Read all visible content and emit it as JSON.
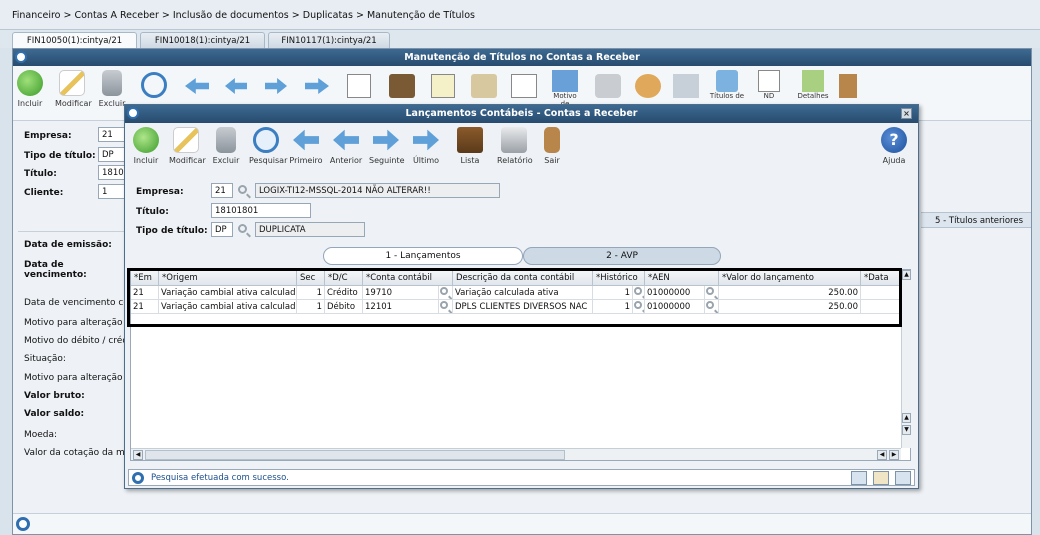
{
  "breadcrumb": "Financeiro > Contas A Receber > Inclusão de documentos > Duplicatas > Manutenção de Títulos",
  "tabs": [
    {
      "label": "FIN10050(1):cintya/21"
    },
    {
      "label": "FIN10018(1):cintya/21"
    },
    {
      "label": "FIN10117(1):cintya/21"
    }
  ],
  "main": {
    "title": "Manutenção de Títulos no Contas a Receber",
    "toolbar": {
      "incluir": "Incluir",
      "modificar": "Modificar",
      "excluir": "Excluir"
    },
    "top_partial_labels": {
      "motivo": "Motivo de",
      "titulos": "Títulos de",
      "nd": "ND",
      "detalhes": "Detalhes"
    },
    "fields": {
      "empresa_label": "Empresa:",
      "empresa": "21",
      "tipo_label": "Tipo de título:",
      "tipo": "DP",
      "titulo_label": "Título:",
      "titulo": "18101",
      "cliente_label": "Cliente:",
      "cliente": "1"
    },
    "titulos_anteriores": "5 - Títulos anteriores",
    "left_labels": {
      "data_emissao": "Data de emissão:",
      "data_vencimento": "Data de vencimento:",
      "data_venc_com": "Data de vencimento com",
      "motivo_alteracao": "Motivo para alteração de",
      "motivo_debito": "Motivo do débito / crédito:",
      "situacao": "Situação:",
      "motivo_alteracao_da": "Motivo para alteração da",
      "valor_bruto": "Valor bruto:",
      "valor_saldo": "Valor saldo:",
      "moeda": "Moeda:",
      "valor_cotacao": "Valor da cotação da moe"
    }
  },
  "modal": {
    "title": "Lançamentos Contábeis - Contas a Receber",
    "toolbar": {
      "incluir": "Incluir",
      "modificar": "Modificar",
      "excluir": "Excluir",
      "pesquisar": "Pesquisar",
      "primeiro": "Primeiro",
      "anterior": "Anterior",
      "seguinte": "Seguinte",
      "ultimo": "Último",
      "lista": "Lista",
      "relatorio": "Relatório",
      "sair": "Sair",
      "ajuda": "Ajuda"
    },
    "form": {
      "empresa_label": "Empresa:",
      "empresa": "21",
      "empresa_desc": "LOGIX-TI12-MSSQL-2014 NÃO ALTERAR!!",
      "titulo_label": "Título:",
      "titulo": "18101801",
      "tipo_label": "Tipo de título:",
      "tipo": "DP",
      "tipo_desc": "DUPLICATA"
    },
    "subtabs": [
      {
        "label": "1 - Lançamentos"
      },
      {
        "label": "2 - AVP"
      }
    ],
    "grid": {
      "headers": [
        "*Em",
        "*Origem",
        "Sec",
        "*D/C",
        "*Conta contábil",
        "Descrição da conta contábil",
        "*Histórico",
        "*AEN",
        "*Valor do lançamento",
        "*Data"
      ],
      "rows": [
        [
          "21",
          "Variação cambial ativa calculada",
          "1",
          "Crédito",
          "19710",
          "Variação calculada ativa",
          "1",
          "01000000",
          "250.00",
          ""
        ],
        [
          "21",
          "Variação cambial ativa calculada",
          "1",
          "Débito",
          "12101",
          "DPLS CLIENTES DIVERSOS NAC",
          "1",
          "01000000",
          "250.00",
          ""
        ]
      ]
    },
    "status": "Pesquisa efetuada com sucesso."
  },
  "colors": {
    "titlebar": "#2f5a80",
    "accent": "#2f6fb0",
    "highlight": "#000000"
  }
}
